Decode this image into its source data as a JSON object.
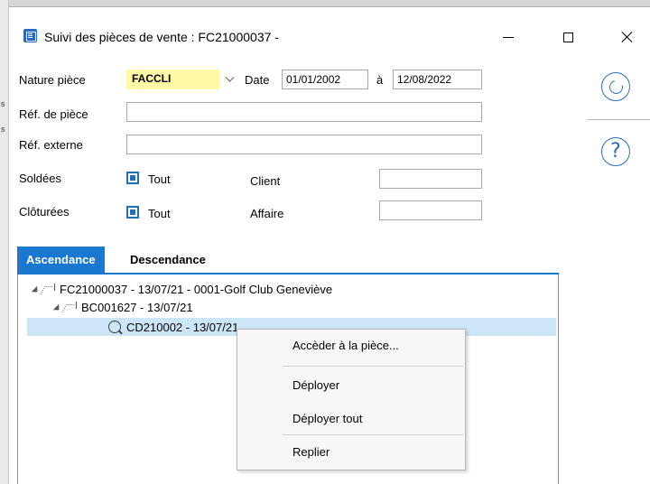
{
  "window": {
    "title": "Suivi des pièces de vente : FC21000037 -"
  },
  "form": {
    "nature_label": "Nature pièce",
    "nature_value": "FACCLI",
    "date_label": "Date",
    "date_from": "01/01/2002",
    "date_sep": "à",
    "date_to": "12/08/2022",
    "ref_piece_label": "Réf. de pièce",
    "ref_piece_value": "",
    "ref_externe_label": "Réf. externe",
    "ref_externe_value": "",
    "soldees_label": "Soldées",
    "soldees_checkbox_label": "Tout",
    "cloturees_label": "Clôturées",
    "cloturees_checkbox_label": "Tout",
    "client_label": "Client",
    "client_value": "",
    "affaire_label": "Affaire",
    "affaire_value": ""
  },
  "side": {
    "refresh_icon": "refresh-icon",
    "help_icon": "help-icon"
  },
  "tabs": [
    {
      "label": "Ascendance",
      "active": true
    },
    {
      "label": "Descendance",
      "active": false
    }
  ],
  "tree": [
    {
      "label": "FC21000037 - 13/07/21 - 0001-Golf Club Geneviève",
      "level": 0
    },
    {
      "label": "BC001627 - 13/07/21",
      "level": 1
    },
    {
      "label": "CD210002 - 13/07/21",
      "level": 2,
      "selected": true
    }
  ],
  "context_menu": {
    "items": [
      "Accèder à la pièce...",
      "Déployer",
      "Déployer tout",
      "Replier"
    ]
  },
  "colors": {
    "accent": "#1b78d0",
    "highlight": "#fff9a6",
    "selection": "#cde6f7"
  }
}
